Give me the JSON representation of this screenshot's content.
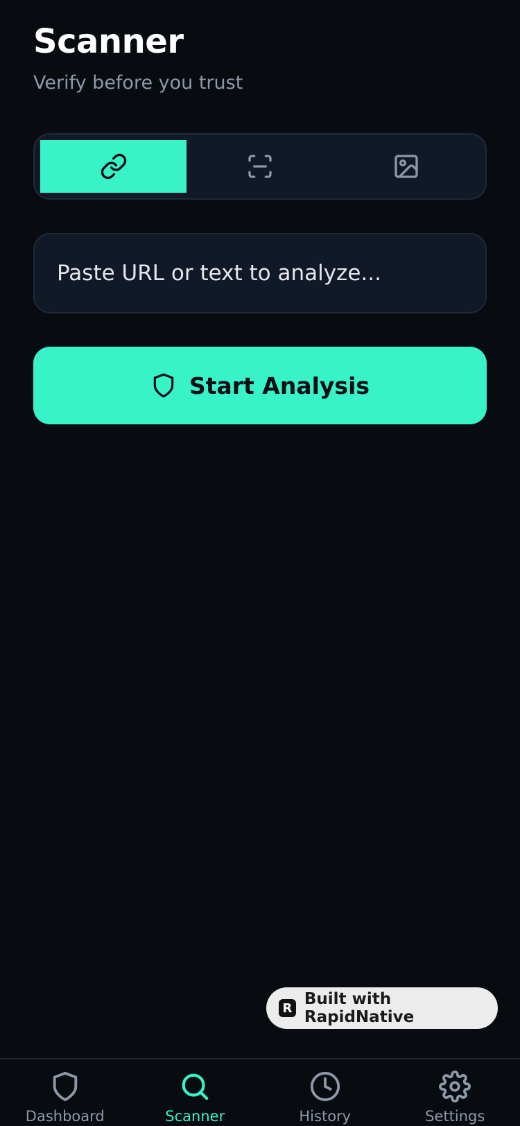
{
  "header": {
    "title": "Scanner",
    "subtitle": "Verify before you trust"
  },
  "mode_tabs": [
    {
      "icon": "link-icon",
      "active": true
    },
    {
      "icon": "scan-icon",
      "active": false
    },
    {
      "icon": "image-icon",
      "active": false
    }
  ],
  "input": {
    "placeholder": "Paste URL or text to analyze...",
    "value": ""
  },
  "start_button": {
    "label": "Start Analysis",
    "icon": "shield-icon"
  },
  "badge": {
    "logo": "R",
    "label": "Built with RapidNative"
  },
  "bottom_nav": {
    "items": [
      {
        "label": "Dashboard",
        "icon": "shield-icon",
        "active": false
      },
      {
        "label": "Scanner",
        "icon": "search-icon",
        "active": true
      },
      {
        "label": "History",
        "icon": "clock-icon",
        "active": false
      },
      {
        "label": "Settings",
        "icon": "gear-icon",
        "active": false
      }
    ]
  },
  "colors": {
    "background": "#080b10",
    "accent": "#38f2c8",
    "surface": "#111827",
    "muted_text": "#8e98a8"
  }
}
